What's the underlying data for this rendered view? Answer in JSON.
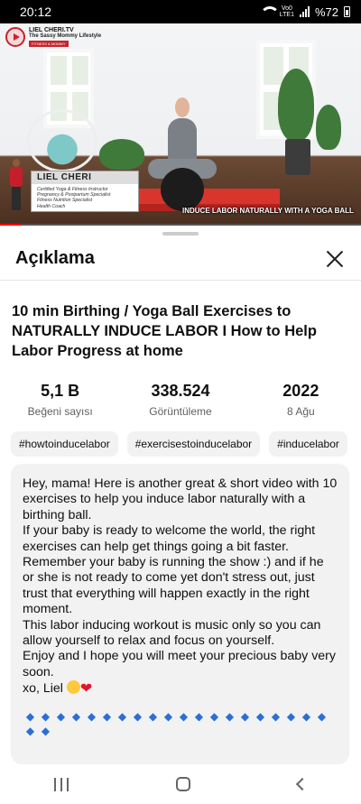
{
  "status_bar": {
    "time": "20:12",
    "network_top": "Vo0",
    "network_bottom": "LTE1",
    "battery": "%72",
    "wifi_icon": "wifi-icon",
    "signal_icon": "signal-icon",
    "battery_icon": "battery-icon"
  },
  "video": {
    "channel_name": "LIEL CHERI.TV",
    "channel_subtitle": "The Sassy Mommy Lifestyle",
    "channel_tag": "FITNESS & MOMMY",
    "lower_third_name": "LIEL CHERI",
    "lower_third_desc": [
      "Certified Yoga & Fitness Instructor",
      "Pregnancy & Postpartum Specialist",
      "Fitness Nutrition Specialist",
      "Health Coach"
    ],
    "caption": "INDUCE LABOR NATURALLY WITH A YOGA BALL",
    "progress_fraction": 0.06
  },
  "sheet": {
    "title": "Açıklama",
    "close_icon": "close-icon"
  },
  "video_title": "10 min Birthing / Yoga Ball Exercises to NATURALLY INDUCE LABOR I How to Help Labor Progress at home",
  "stats": [
    {
      "value": "5,1 B",
      "label": "Beğeni sayısı"
    },
    {
      "value": "338.524",
      "label": "Görüntüleme"
    },
    {
      "value": "2022",
      "label": "8 Ağu"
    }
  ],
  "tags": [
    "#howtoinducelabor",
    "#exercisestoinducelabor",
    "#inducelabor"
  ],
  "description": {
    "lines": [
      "Hey, mama! Here is another great & short video with 10 exercises to help you induce labor naturally with a birthing ball.",
      "If your baby is ready to welcome the world, the right exercises can help get things going a bit faster.",
      "Remember your baby is running the show :) and if he or she is not ready to come yet don't stress out, just trust that everything will happen exactly in the right moment.",
      "This labor inducing workout is music only so you can allow yourself to relax and focus on yourself.",
      "Enjoy and I hope you will meet your precious baby very soon."
    ],
    "signoff": "xo, Liel",
    "diamond_count": 22
  },
  "nav": {
    "recents_icon": "recents-icon",
    "home_icon": "home-icon",
    "back_icon": "back-icon"
  }
}
